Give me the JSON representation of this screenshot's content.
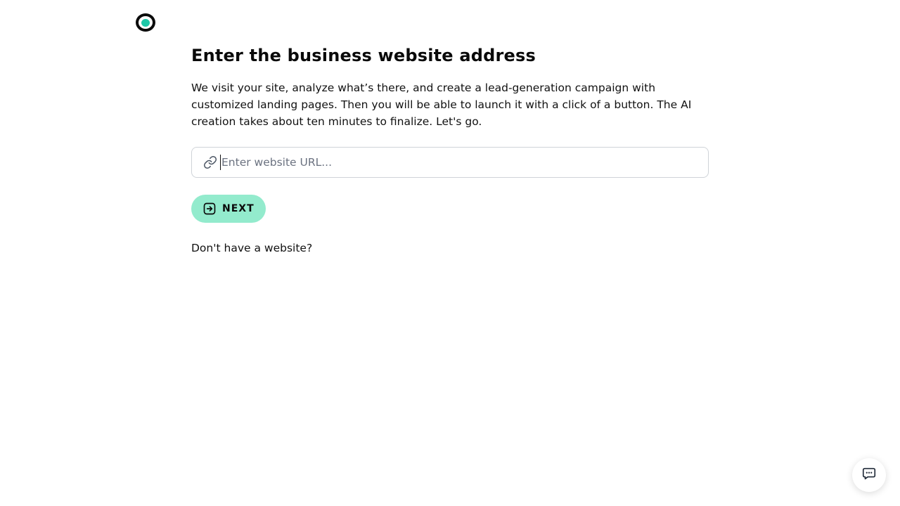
{
  "brand": {
    "logo_icon": "eye-logo-icon",
    "accent_color": "#1ec8a8"
  },
  "main": {
    "title": "Enter the business website address",
    "description": "We visit your site, analyze what’s there, and create a lead-generation campaign with customized landing pages. Then you will be able to launch it with a click of a button. The AI creation takes about ten minutes to finalize. Let's go.",
    "url_input": {
      "icon": "link-icon",
      "value": "",
      "placeholder": "Enter website URL..."
    },
    "next_button": {
      "icon": "arrow-right-square-icon",
      "label": "NEXT",
      "color": "#93ebcd"
    },
    "no_website_link": "Don't have a website?"
  },
  "chat_widget": {
    "icon": "chat-bubble-icon"
  }
}
